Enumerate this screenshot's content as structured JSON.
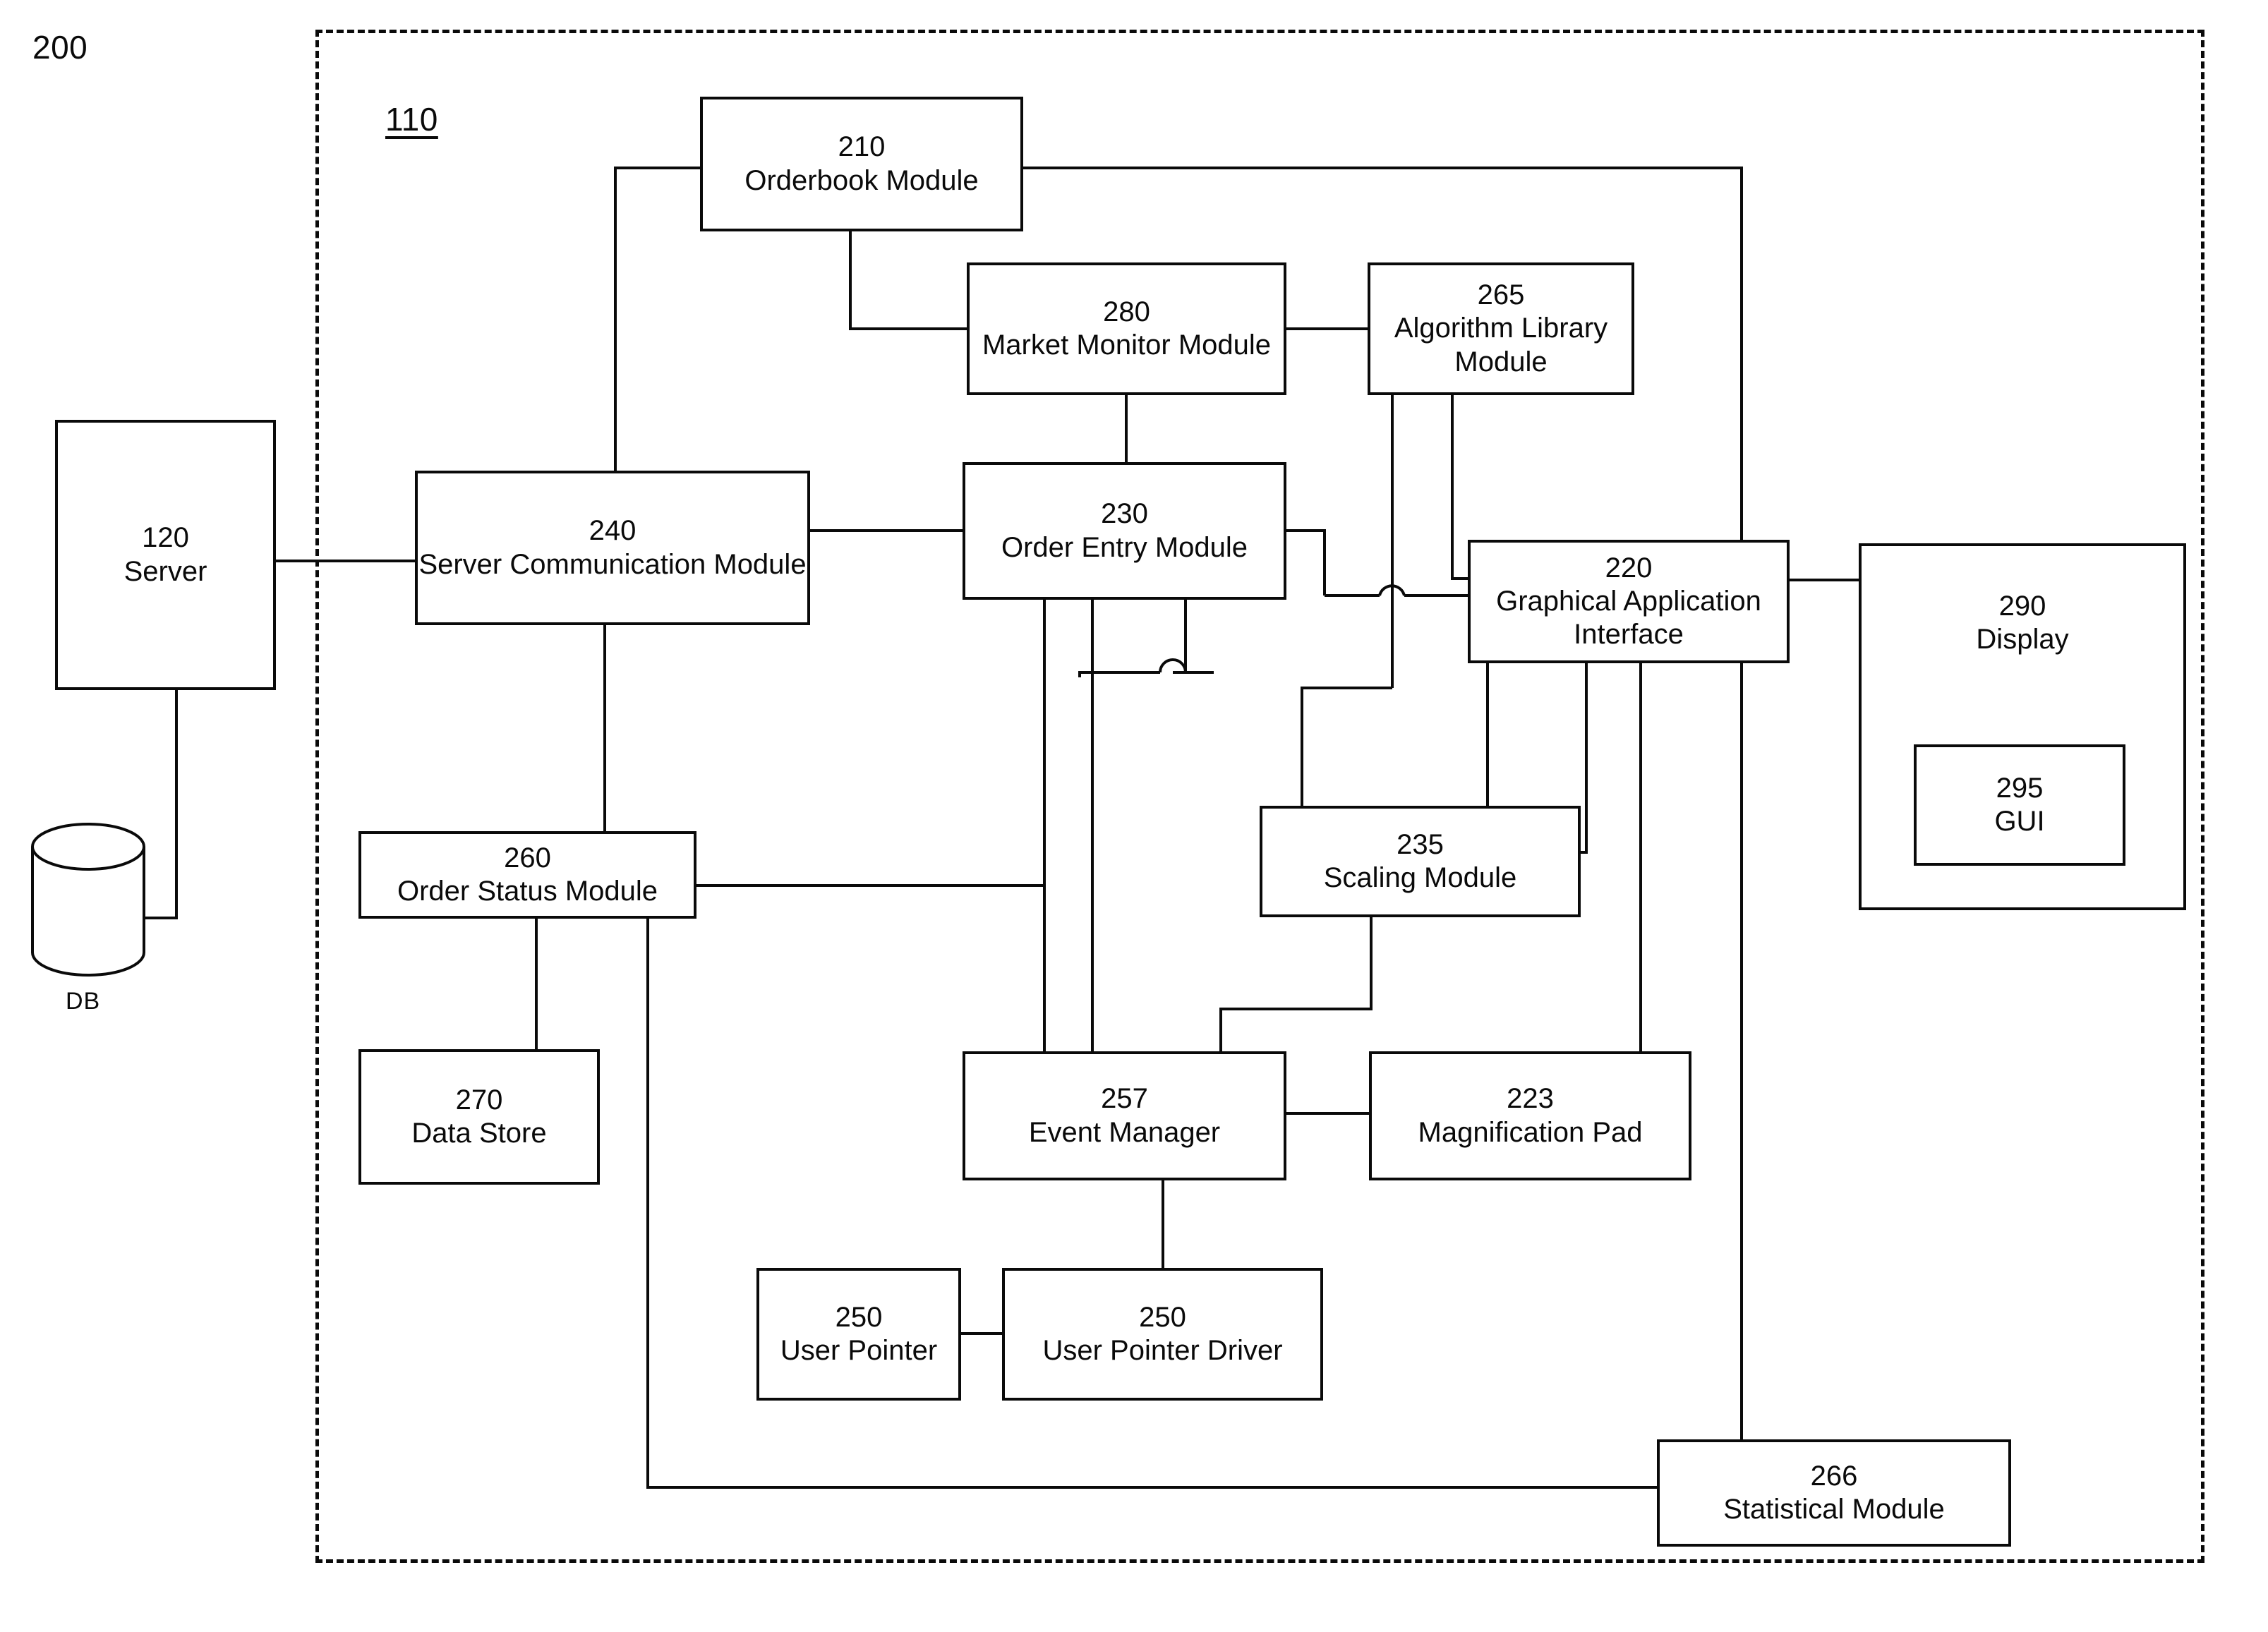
{
  "figure": {
    "system_label": "200",
    "client_label": "110",
    "db_label": "DB"
  },
  "nodes": {
    "server": {
      "ref": "120",
      "name": "Server"
    },
    "orderbook": {
      "ref": "210",
      "name": "Orderbook Module"
    },
    "market_monitor": {
      "ref": "280",
      "name": "Market Monitor Module"
    },
    "algorithm_lib": {
      "ref": "265",
      "name": "Algorithm Library Module"
    },
    "server_comm": {
      "ref": "240",
      "name": "Server Communication Module"
    },
    "order_entry": {
      "ref": "230",
      "name": "Order Entry Module"
    },
    "gai": {
      "ref": "220",
      "name": "Graphical Application Interface"
    },
    "display": {
      "ref": "290",
      "name": "Display"
    },
    "gui": {
      "ref": "295",
      "name": "GUI"
    },
    "order_status": {
      "ref": "260",
      "name": "Order Status Module"
    },
    "data_store": {
      "ref": "270",
      "name": "Data Store"
    },
    "scaling": {
      "ref": "235",
      "name": "Scaling Module"
    },
    "event_manager": {
      "ref": "257",
      "name": "Event Manager"
    },
    "magnification": {
      "ref": "223",
      "name": "Magnification Pad"
    },
    "user_pointer": {
      "ref": "250",
      "name": "User Pointer"
    },
    "pointer_driver": {
      "ref": "250",
      "name": "User Pointer Driver"
    },
    "statistical": {
      "ref": "266",
      "name": "Statistical Module"
    }
  },
  "colors": {
    "ink": "#0a0a0a",
    "paper": "#ffffff"
  }
}
